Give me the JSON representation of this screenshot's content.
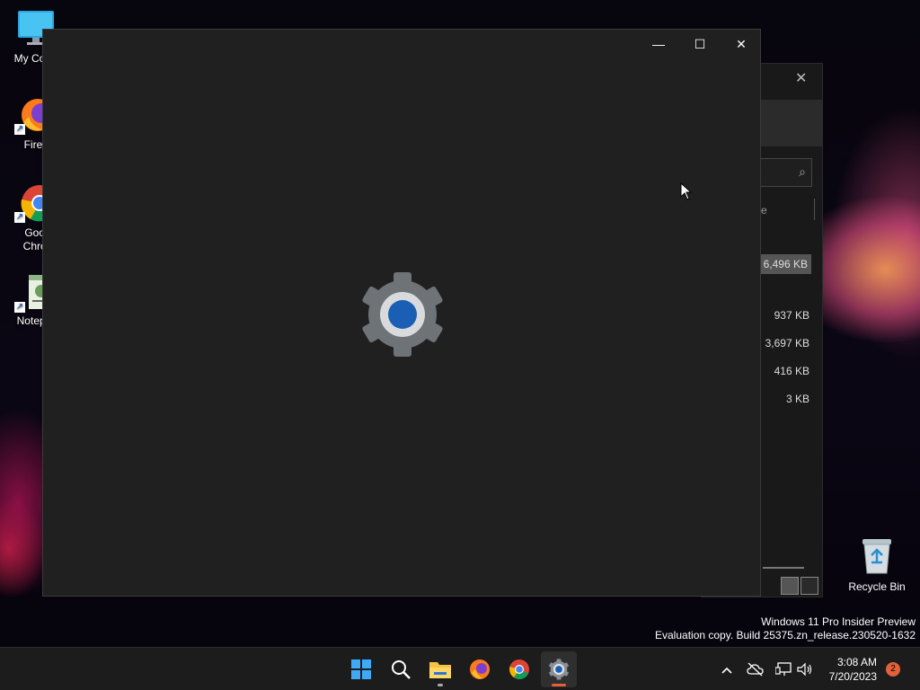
{
  "desktop": {
    "icons": [
      {
        "label": "My Com",
        "icon": "computer-icon"
      },
      {
        "label": "Firefo",
        "icon": "firefox-icon"
      },
      {
        "label": "Goog\nChron",
        "label_line1": "Goog",
        "label_line2": "Chron",
        "icon": "chrome-icon"
      },
      {
        "label": "Notepa",
        "icon": "notepad-icon"
      }
    ],
    "recycle_bin": {
      "label": "Recycle Bin",
      "icon": "recycle-bin-icon"
    }
  },
  "explorer_window": {
    "file_sizes": [
      "6,496 KB",
      "937 KB",
      "3,697 KB",
      "416 KB",
      "3 KB"
    ],
    "column_fragment": "e"
  },
  "settings_window": {
    "controls": {
      "minimize": "—",
      "maximize": "☐",
      "close": "✕"
    },
    "splash_icon": "settings-gear-icon",
    "colors": {
      "background": "#202020",
      "gear_body": "#6e7378",
      "gear_center": "#1a5fb4"
    }
  },
  "watermark": {
    "line1": "Windows 11 Pro Insider Preview",
    "line2": "Evaluation copy. Build 25375.zn_release.230520-1632"
  },
  "taskbar": {
    "apps": [
      {
        "name": "start",
        "icon": "windows-start-icon"
      },
      {
        "name": "search",
        "icon": "search-icon"
      },
      {
        "name": "file-explorer",
        "icon": "folder-icon"
      },
      {
        "name": "firefox",
        "icon": "firefox-icon"
      },
      {
        "name": "chrome",
        "icon": "chrome-icon"
      },
      {
        "name": "settings",
        "icon": "settings-gear-icon"
      }
    ],
    "tray": {
      "overflow": "^",
      "time": "3:08 AM",
      "date": "7/20/2023",
      "notification_count": "2"
    }
  }
}
